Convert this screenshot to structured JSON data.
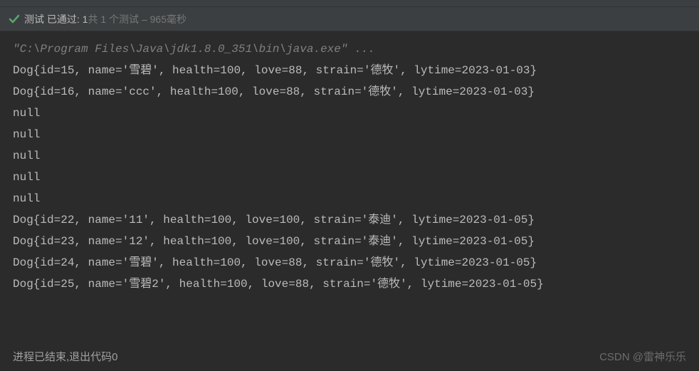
{
  "status": {
    "label_test": "测试",
    "label_passed": "已通过:",
    "passed_count": "1",
    "label_total_prefix": "共",
    "total_count": "1",
    "label_tests": "个测试",
    "separator": "–",
    "duration": "965毫秒"
  },
  "console": {
    "command": "\"C:\\Program Files\\Java\\jdk1.8.0_351\\bin\\java.exe\" ...",
    "lines": [
      "Dog{id=15, name='雪碧', health=100, love=88, strain='德牧', lytime=2023-01-03}",
      "Dog{id=16, name='ccc', health=100, love=88, strain='德牧', lytime=2023-01-03}",
      "null",
      "null",
      "null",
      "null",
      "null",
      "Dog{id=22, name='11', health=100, love=100, strain='泰迪', lytime=2023-01-05}",
      "Dog{id=23, name='12', health=100, love=100, strain='泰迪', lytime=2023-01-05}",
      "Dog{id=24, name='雪碧', health=100, love=88, strain='德牧', lytime=2023-01-05}",
      "Dog{id=25, name='雪碧2', health=100, love=88, strain='德牧', lytime=2023-01-05}"
    ]
  },
  "footer": {
    "exit_message": "进程已结束,退出代码0",
    "watermark": "CSDN @雷神乐乐"
  }
}
